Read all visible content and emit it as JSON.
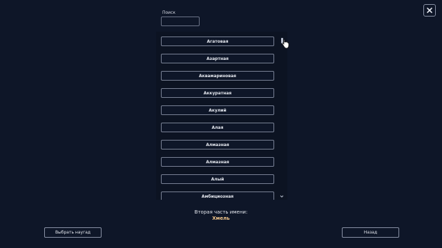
{
  "search": {
    "label": "Поиск",
    "value": "",
    "placeholder": ""
  },
  "list": {
    "items": [
      "Агатовая",
      "Азартная",
      "Аквамариновая",
      "Аккуратная",
      "Акулий",
      "Алая",
      "Алмазная",
      "Алмазная",
      "Алый",
      "Амбициозная"
    ]
  },
  "result": {
    "label": "Вторая часть имени:",
    "value": "Хмель"
  },
  "buttons": {
    "random": "Выбрать наугад",
    "back": "Назад"
  },
  "colors": {
    "background": "#0e1628",
    "accent": "#f0c48a"
  }
}
